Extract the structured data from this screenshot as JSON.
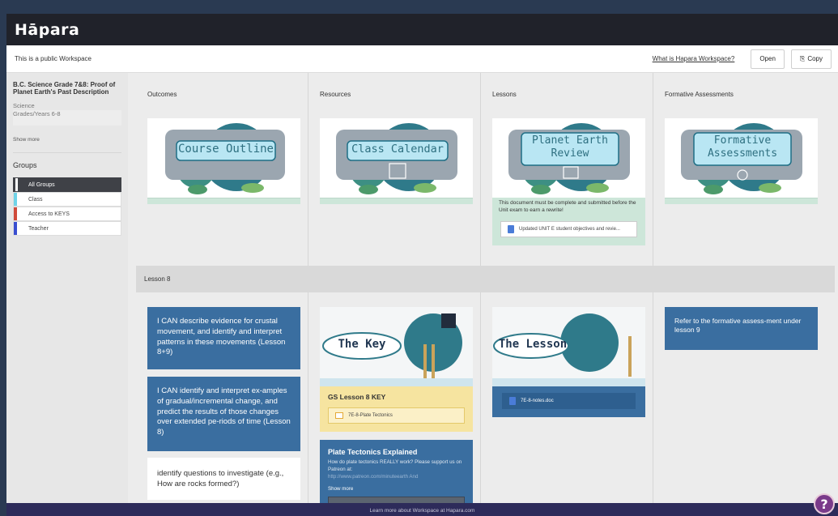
{
  "header": {
    "logo": "Hāpara"
  },
  "subbar": {
    "public_notice": "This is a public Workspace",
    "what_link": "What is Hapara Workspace?",
    "open_label": "Open",
    "copy_label": "Copy"
  },
  "sidebar": {
    "title": "B.C. Science Grade 7&8: Proof of Planet Earth's Past Description",
    "subject": "Science",
    "grades": "Grades/Years 6-8",
    "show_more": "Show more",
    "groups_heading": "Groups",
    "groups": [
      {
        "label": "All Groups",
        "color": "#3f4147"
      },
      {
        "label": "Class",
        "color": "#6fd3e8"
      },
      {
        "label": "Access to KEYS",
        "color": "#d04a3a"
      },
      {
        "label": "Teacher",
        "color": "#3a4fd0"
      }
    ]
  },
  "columns": {
    "outcomes": "Outcomes",
    "resources": "Resources",
    "lessons": "Lessons",
    "formative": "Formative Assessments"
  },
  "cards": {
    "course_outline": "Course Outline",
    "class_calendar": "Class Calendar",
    "planet_review_1": "Planet Earth",
    "planet_review_2": "Review",
    "formative_1": "Formative",
    "formative_2": "Assessments",
    "review_note": "This document must be complete and submitted before the Unit exam to earn a rewrite!",
    "review_doc": "Updated UNIT E student objectives and revie..."
  },
  "lesson8": {
    "heading": "Lesson 8",
    "outcome_1": "I CAN describe evidence for crustal movement, and identify and interpret patterns in these movements (Lesson 8+9)",
    "outcome_2": "I CAN identify and interpret ex-amples of gradual/incremental change, and predict the results of those changes over extended pe-riods of time (Lesson 8)",
    "outcome_3": "identify questions to investigate (e.g., How are rocks formed?)",
    "key_title": "The Key",
    "key_label": "GS Lesson 8 KEY",
    "key_doc": "7E-8-Plate Tectonics",
    "plate_title": "Plate Tectonics Explained",
    "plate_desc": "How do plate tectonics REALLY work? Please support us on Patreon at:",
    "plate_link": "http://www.patreon.com/minuteearth And",
    "plate_more": "Show more",
    "lesson_title": "The Lesson",
    "lesson_doc": "7E-8-notes.doc",
    "formative_note": "Refer to the formative assess-ment under lesson 9"
  },
  "footer": {
    "text": "Learn more about Workspace at Hapara.com",
    "help": "?"
  },
  "colors": {
    "card_blue": "#3a6ea0",
    "topbar": "#20222a",
    "footer": "#2d2b5a",
    "key_yellow": "#f6e4a0"
  }
}
